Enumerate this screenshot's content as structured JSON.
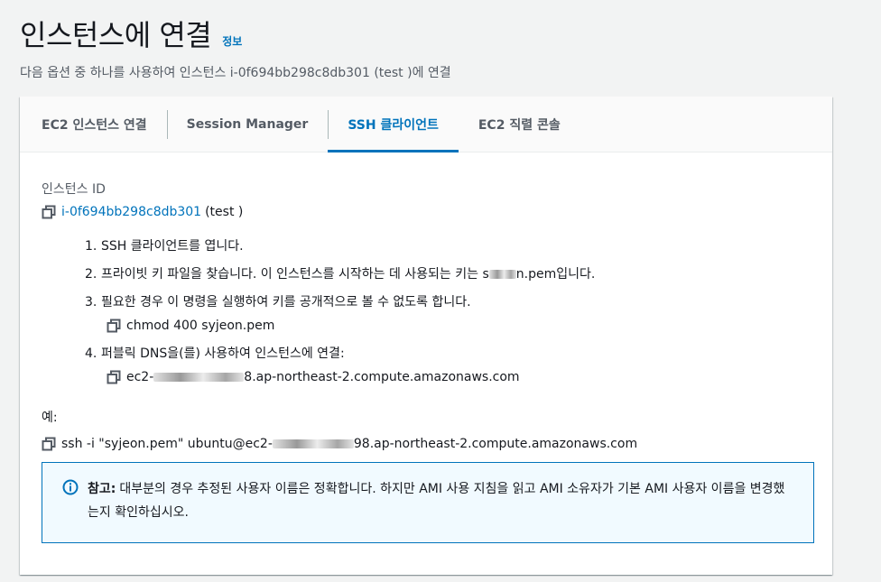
{
  "header": {
    "title": "인스턴스에 연결",
    "info_link": "정보",
    "subtitle": "다음 옵션 중 하나를 사용하여 인스턴스 i-0f694bb298c8db301 (test )에 연결"
  },
  "tabs": [
    {
      "label": "EC2 인스턴스 연결",
      "active": false
    },
    {
      "label": "Session Manager",
      "active": false
    },
    {
      "label": "SSH 클라이언트",
      "active": true
    },
    {
      "label": "EC2 직렬 콘솔",
      "active": false
    }
  ],
  "instance": {
    "label": "인스턴스 ID",
    "id": "i-0f694bb298c8db301",
    "name": "(test )"
  },
  "steps": [
    {
      "num": "1.",
      "text": "SSH 클라이언트를 엽니다."
    },
    {
      "num": "2.",
      "text_before": "프라이빗 키 파일을 찾습니다. 이 인스턴스를 시작하는 데 사용되는 키는 s",
      "text_after": "n.pem입니다."
    },
    {
      "num": "3.",
      "text": "필요한 경우 이 명령을 실행하여 키를 공개적으로 볼 수 없도록 합니다.",
      "command": "chmod 400 syjeon.pem"
    },
    {
      "num": "4.",
      "text": "퍼블릭 DNS을(를) 사용하여 인스턴스에 연결:",
      "command_before": "ec2-",
      "command_after": "8.ap-northeast-2.compute.amazonaws.com"
    }
  ],
  "example": {
    "label": "예:",
    "command_before": "ssh -i \"syjeon.pem\" ubuntu@ec2-",
    "command_after": "98.ap-northeast-2.compute.amazonaws.com"
  },
  "alert": {
    "title": "참고:",
    "text": "대부분의 경우 추정된 사용자 이름은 정확합니다. 하지만 AMI 사용 지침을 읽고 AMI 소유자가 기본 AMI 사용자 이름을 변경했는지 확인하십시오."
  },
  "colors": {
    "accent": "#0073bb",
    "background": "#f2f3f3",
    "alert_background": "#f1faff"
  },
  "icons": {
    "copy": "copy-icon",
    "info": "info-circle-icon"
  }
}
